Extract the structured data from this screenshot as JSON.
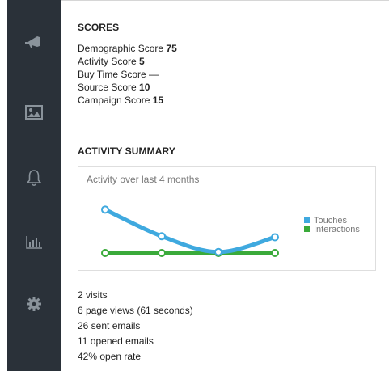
{
  "sidebar": {
    "items": [
      {
        "icon": "megaphone-icon",
        "name": "nav-campaigns"
      },
      {
        "icon": "image-icon",
        "name": "nav-media"
      },
      {
        "icon": "bell-icon",
        "name": "nav-notifications"
      },
      {
        "icon": "bar-chart-icon",
        "name": "nav-reports"
      },
      {
        "icon": "gear-icon",
        "name": "nav-settings"
      }
    ],
    "bg": "#2a3139",
    "icon_color": "#8a939b"
  },
  "scores": {
    "title": "SCORES",
    "rows": [
      {
        "label": "Demographic Score",
        "value": "75"
      },
      {
        "label": "Activity Score",
        "value": "5"
      },
      {
        "label": "Buy Time Score",
        "value": "—"
      },
      {
        "label": "Source Score",
        "value": "10"
      },
      {
        "label": "Campaign Score",
        "value": "15"
      }
    ]
  },
  "activity": {
    "title": "ACTIVITY SUMMARY",
    "chart_title": "Activity over last 4 months",
    "stats": [
      "2 visits",
      "6 page views (61 seconds)",
      "26 sent emails",
      "11 opened emails",
      "42% open rate"
    ]
  },
  "chart_data": {
    "type": "line",
    "title": "Activity over last 4 months",
    "x": [
      1,
      2,
      3,
      4
    ],
    "ylim": [
      0,
      5
    ],
    "grid": false,
    "legend": "right",
    "series": [
      {
        "name": "Touches",
        "color": "#3fa9df",
        "values": [
          4.4,
          1.7,
          0.1,
          1.6
        ]
      },
      {
        "name": "Interactions",
        "color": "#3aaa3a",
        "values": [
          0,
          0,
          0,
          0
        ]
      }
    ]
  }
}
